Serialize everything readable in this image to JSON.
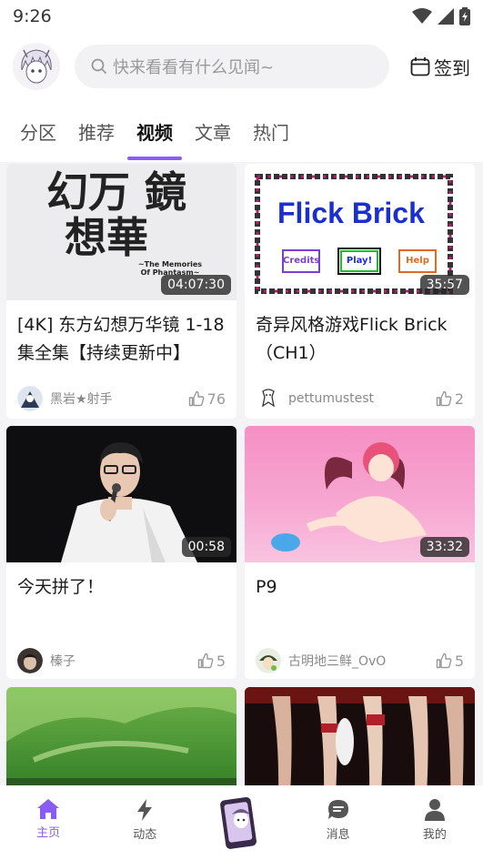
{
  "status_bar": {
    "time": "9:26"
  },
  "header": {
    "search_placeholder": "快来看看有什么见闻~",
    "checkin_label": "签到"
  },
  "tabs": [
    {
      "label": "分区"
    },
    {
      "label": "推荐"
    },
    {
      "label": "视频",
      "active": true
    },
    {
      "label": "文章"
    },
    {
      "label": "热门"
    }
  ],
  "cards": [
    {
      "title": "[4K] 东方幻想万华镜 1-18集全集【持续更新中】",
      "thumb_text": {
        "line1": "幻万 鏡",
        "line2": "想華",
        "subtitle": "~The Memories Of Phantasm~"
      },
      "duration": "04:07:30",
      "author": "黑岩★射手",
      "likes": "76"
    },
    {
      "title": "奇异风格游戏Flick Brick（CH1）",
      "thumb_text": {
        "game_title": "Flick Brick",
        "credits": "Credits",
        "play": "Play!",
        "help": "Help"
      },
      "duration": "35:57",
      "author": "pettumustest",
      "likes": "2"
    },
    {
      "title": "今天拼了！",
      "duration": "00:58",
      "author": "榛子",
      "likes": "5"
    },
    {
      "title": "P9",
      "duration": "33:32",
      "author": "古明地三鲜_OvO",
      "likes": "5"
    },
    {
      "title": "",
      "duration": "",
      "author": "",
      "likes": ""
    },
    {
      "title": "",
      "duration": "",
      "author": "",
      "likes": ""
    }
  ],
  "bottom_nav": [
    {
      "label": "主页",
      "icon": "home-icon",
      "active": true
    },
    {
      "label": "动态",
      "icon": "lightning-icon"
    },
    {
      "label": "",
      "icon": "phone-character-icon"
    },
    {
      "label": "消息",
      "icon": "chat-icon"
    },
    {
      "label": "我的",
      "icon": "user-icon"
    }
  ],
  "colors": {
    "accent": "#8a5cf6",
    "background": "#f4f4f6"
  }
}
